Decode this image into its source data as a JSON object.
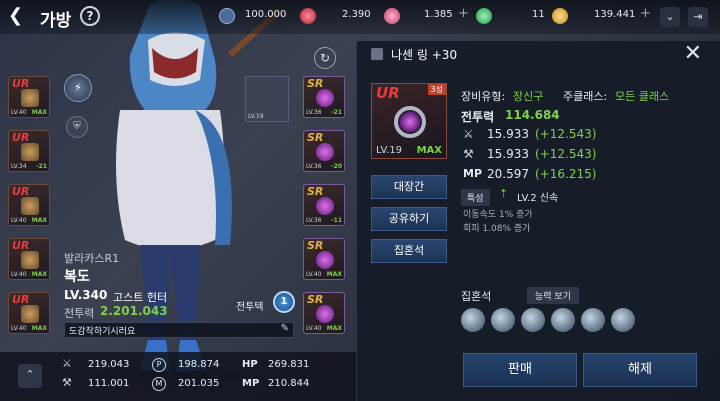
{
  "header": {
    "title": "가방",
    "help": "?"
  },
  "currencies": [
    {
      "value": "100.000",
      "icon": "energy-icon"
    },
    {
      "value": "2.390",
      "icon": "red-gem-icon"
    },
    {
      "value": "1.385",
      "icon": "pink-gem-icon"
    },
    {
      "value": "11",
      "icon": "green-gem-icon"
    },
    {
      "value": "139.441",
      "icon": "gold-coin-icon"
    }
  ],
  "left_slots": [
    {
      "grade": "UR",
      "lv": "LV.40",
      "max": "MAX"
    },
    {
      "grade": "UR",
      "lv": "LV.34",
      "max": "-21"
    },
    {
      "grade": "UR",
      "lv": "LV.40",
      "max": "MAX"
    },
    {
      "grade": "UR",
      "lv": "LV.40",
      "max": "MAX"
    },
    {
      "grade": "UR",
      "lv": "LV.40",
      "max": "MAX"
    }
  ],
  "right_slots": [
    {
      "grade": "SR",
      "lv": "LV.36",
      "max": "-21"
    },
    {
      "grade": "SR",
      "lv": "LV.36",
      "max": "-20"
    },
    {
      "grade": "SR",
      "lv": "LV.36",
      "max": "-11"
    },
    {
      "grade": "SR",
      "lv": "LV.40",
      "max": "MAX"
    },
    {
      "grade": "SR",
      "lv": "LV.40",
      "max": "MAX"
    }
  ],
  "mid_slot": {
    "lv": "LV.19"
  },
  "character": {
    "server": "발라카스R1",
    "name": "복도",
    "level": "LV.340",
    "class": "고스트 헌터",
    "power_label": "전투력",
    "power": "2.201.043",
    "title": "도감작하기시러요",
    "stars": "1"
  },
  "bottom_stats": [
    {
      "label": "",
      "value": "219.043",
      "icon": "sword-icon"
    },
    {
      "label": "",
      "value": "111.001",
      "icon": "axe-icon"
    },
    {
      "label": "",
      "value": "198.874",
      "icon": "p-icon"
    },
    {
      "label": "",
      "value": "201.035",
      "icon": "m-icon"
    },
    {
      "label": "HP",
      "value": "269.831"
    },
    {
      "label": "MP",
      "value": "210.844"
    }
  ],
  "item": {
    "name": "나센 링 +30",
    "grade": "UR",
    "stars": "3성",
    "lv": "LV.19",
    "max": "MAX",
    "type_label": "장비유형:",
    "type_value": "장신구",
    "class_label": "주클래스:",
    "class_value": "모든 클래스",
    "power_label": "전투력",
    "power": "114.684",
    "stats": [
      {
        "icon": "sword-icon",
        "value": "15.933",
        "bonus": "(+12.543)"
      },
      {
        "icon": "axe-icon",
        "value": "15.933",
        "bonus": "(+12.543)"
      },
      {
        "label": "MP",
        "value": "20.597",
        "bonus": "(+16.215)"
      }
    ],
    "trait_label": "특성",
    "trait_value": "LV.2 신속",
    "trait_lines": [
      "이동속도 1% 증가",
      "회피 1.08% 증가"
    ],
    "buttons": [
      "대장간",
      "공유하기",
      "집혼석"
    ],
    "soul_label": "집혼석",
    "soul_btn": "능력 보기",
    "sell": "판매",
    "unequip": "해제"
  },
  "colors": {
    "green": "#7fd14a",
    "ur": "#e83c3c",
    "sr": "#e0b045",
    "accent": "#2a4670"
  }
}
